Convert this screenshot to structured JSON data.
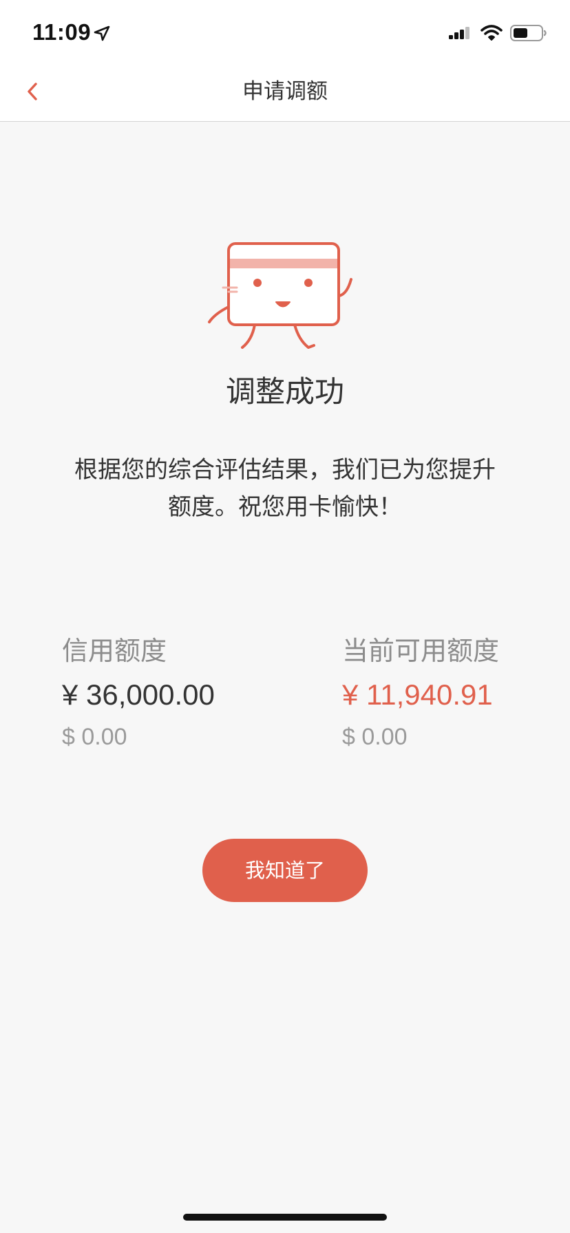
{
  "status_bar": {
    "time": "11:09",
    "icons": [
      "location-arrow-icon",
      "signal-icon",
      "wifi-icon",
      "battery-icon"
    ]
  },
  "nav": {
    "title": "申请调额",
    "back_icon": "chevron-left-icon"
  },
  "result": {
    "illustration": "card-mascot-icon",
    "title": "调整成功",
    "message": "根据您的综合评估结果，我们已为您提升额度。祝您用卡愉快！"
  },
  "limits": {
    "credit": {
      "label": "信用额度",
      "cny": "¥ 36,000.00",
      "usd": "$ 0.00"
    },
    "available": {
      "label": "当前可用额度",
      "cny": "¥ 11,940.91",
      "usd": "$ 0.00"
    }
  },
  "actions": {
    "confirm_label": "我知道了"
  },
  "colors": {
    "accent": "#e0604c",
    "background": "#f7f7f7",
    "text": "#333333",
    "muted": "#8c8c8c"
  }
}
